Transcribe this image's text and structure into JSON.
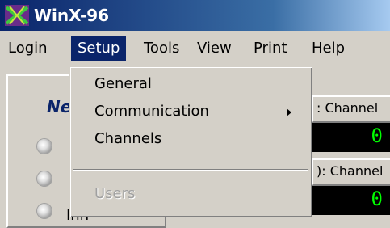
{
  "window": {
    "title": "WinX-96",
    "icon": "winx-app-icon"
  },
  "menubar": {
    "items": [
      {
        "label": "Login"
      },
      {
        "label": "Setup"
      },
      {
        "label": "Tools"
      },
      {
        "label": "View"
      },
      {
        "label": "Print"
      },
      {
        "label": "Help"
      }
    ],
    "active": "Setup"
  },
  "setup_menu": {
    "items": [
      {
        "label": "General"
      },
      {
        "label": "Communication",
        "submenu_icon": "chevron-right-icon"
      },
      {
        "label": "Channels"
      },
      {
        "label": "Users",
        "disabled": true
      }
    ]
  },
  "background": {
    "heading_fragment": "Ne",
    "led_label_fragment": "Inn",
    "channels": [
      {
        "label": ": Channel",
        "value": "0"
      },
      {
        "label": "): Channel",
        "value": "0"
      }
    ]
  },
  "colors": {
    "title_bar": "#0a246a",
    "menu_highlight": "#0a246a",
    "display_text": "#00ff00",
    "face": "#d4d0c8"
  }
}
